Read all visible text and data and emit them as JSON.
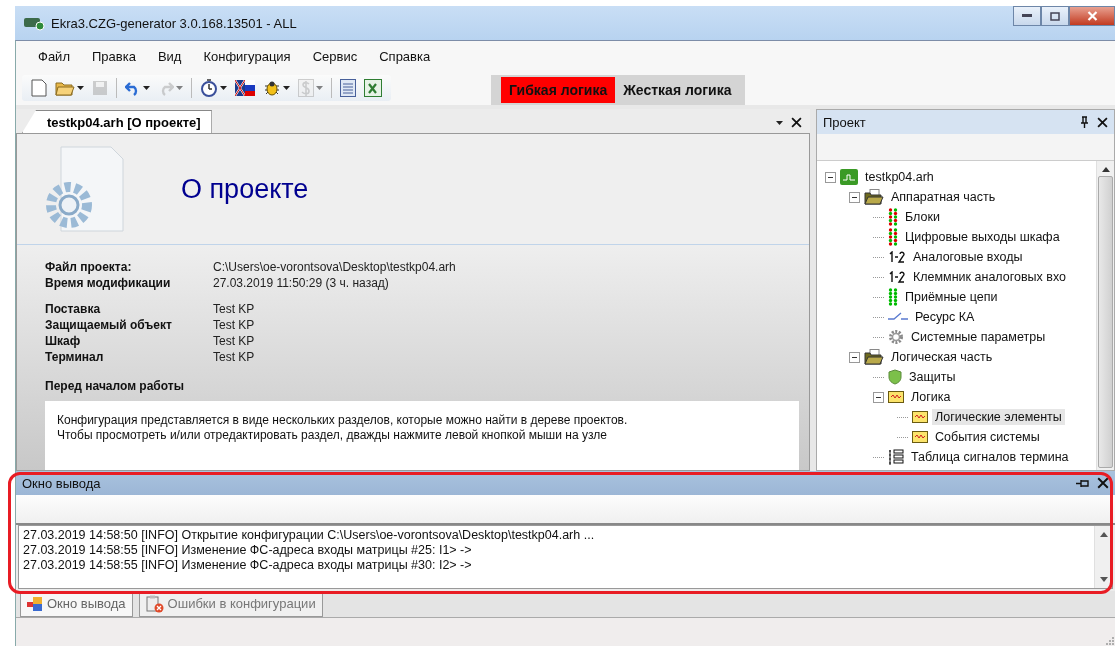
{
  "window": {
    "title": "Ekra3.CZG-generator 3.0.168.13501 - ALL"
  },
  "menu": [
    "Файл",
    "Правка",
    "Вид",
    "Конфигурация",
    "Сервис",
    "Справка"
  ],
  "toolbar": [
    {
      "kind": "new",
      "dropdown": false,
      "disabled": false
    },
    {
      "kind": "open",
      "dropdown": true,
      "disabled": false
    },
    {
      "kind": "save",
      "dropdown": false,
      "disabled": true
    },
    {
      "kind": "separator"
    },
    {
      "kind": "undo",
      "dropdown": true,
      "disabled": false
    },
    {
      "kind": "redo",
      "dropdown": true,
      "disabled": true
    },
    {
      "kind": "separator"
    },
    {
      "kind": "timer",
      "dropdown": true,
      "disabled": false
    },
    {
      "kind": "flag",
      "dropdown": false,
      "disabled": false
    },
    {
      "kind": "bug",
      "dropdown": true,
      "disabled": false
    },
    {
      "kind": "currency",
      "dropdown": true,
      "disabled": true
    },
    {
      "kind": "separator"
    },
    {
      "kind": "list",
      "dropdown": false,
      "disabled": false
    },
    {
      "kind": "excel",
      "dropdown": false,
      "disabled": false
    }
  ],
  "logic_mode": [
    {
      "label": "Гибкая логика",
      "selected": true
    },
    {
      "label": "Жесткая логика",
      "selected": false
    }
  ],
  "document": {
    "tab": "testkp04.arh [О проекте]",
    "heading": "О проекте",
    "file_info": [
      {
        "label": "Файл проекта:",
        "value": "C:\\Users\\oe-vorontsova\\Desktop\\testkp04.arh"
      },
      {
        "label": "Время модификации",
        "value": "27.03.2019 11:50:29 (3 ч. назад)"
      }
    ],
    "properties": [
      {
        "label": "Поставка",
        "value": "Test KP"
      },
      {
        "label": "Защищаемый объект",
        "value": "Test KP"
      },
      {
        "label": "Шкаф",
        "value": "Test KP"
      },
      {
        "label": "Терминал",
        "value": "Test KP"
      }
    ],
    "section_title": "Перед началом работы",
    "description": [
      "Конфигурация представляется в виде нескольких разделов, которые можно найти в дереве проектов.",
      "Чтобы просмотреть и/или отредактировать раздел, дважды нажмите левой кнопкой мыши на узле"
    ]
  },
  "project_panel": {
    "title": "Проект",
    "tree": [
      {
        "label": "testkp04.arh",
        "kind": "project",
        "selected": false,
        "expanded": true,
        "children": [
          {
            "label": "Аппаратная часть",
            "kind": "folder",
            "selected": false,
            "expanded": true,
            "children": [
              {
                "label": "Блоки",
                "kind": "leds-mixed",
                "selected": false
              },
              {
                "label": "Цифровые выходы шкафа",
                "kind": "leds-mixed",
                "selected": false
              },
              {
                "label": "Аналоговые входы",
                "kind": "numbers",
                "selected": false
              },
              {
                "label": "Клеммник аналоговых вхо",
                "kind": "numbers",
                "selected": false
              },
              {
                "label": "Приёмные цепи",
                "kind": "leds-green",
                "selected": false
              },
              {
                "label": "Ресурс КА",
                "kind": "switch",
                "selected": false
              },
              {
                "label": "Системные параметры",
                "kind": "gear",
                "selected": false
              }
            ]
          },
          {
            "label": "Логическая часть",
            "kind": "folder",
            "selected": false,
            "expanded": true,
            "children": [
              {
                "label": "Защиты",
                "kind": "shield",
                "selected": false
              },
              {
                "label": "Логика",
                "kind": "logic",
                "selected": false,
                "expanded": true,
                "children": [
                  {
                    "label": "Логические элементы",
                    "kind": "logic",
                    "selected": true
                  },
                  {
                    "label": "События системы",
                    "kind": "logic",
                    "selected": false
                  }
                ]
              },
              {
                "label": "Таблица сигналов термина",
                "kind": "table",
                "selected": false
              }
            ]
          }
        ]
      }
    ]
  },
  "output_panel": {
    "title": "Окно вывода",
    "lines": [
      "27.03.2019 14:58:50 [INFO] Открытие конфигурации C:\\Users\\oe-vorontsova\\Desktop\\testkp04.arh ...",
      "27.03.2019 14:58:55 [INFO] Изменение ФС-адреса входы матрицы #25: I1> ->",
      "27.03.2019 14:58:55 [INFO] Изменение ФС-адреса входы матрицы #30: I2> ->"
    ]
  },
  "bottom_tabs": [
    {
      "label": "Окно вывода",
      "kind": "output",
      "selected": true
    },
    {
      "label": "Ошибки в конфигурации",
      "kind": "errors",
      "selected": false
    }
  ]
}
